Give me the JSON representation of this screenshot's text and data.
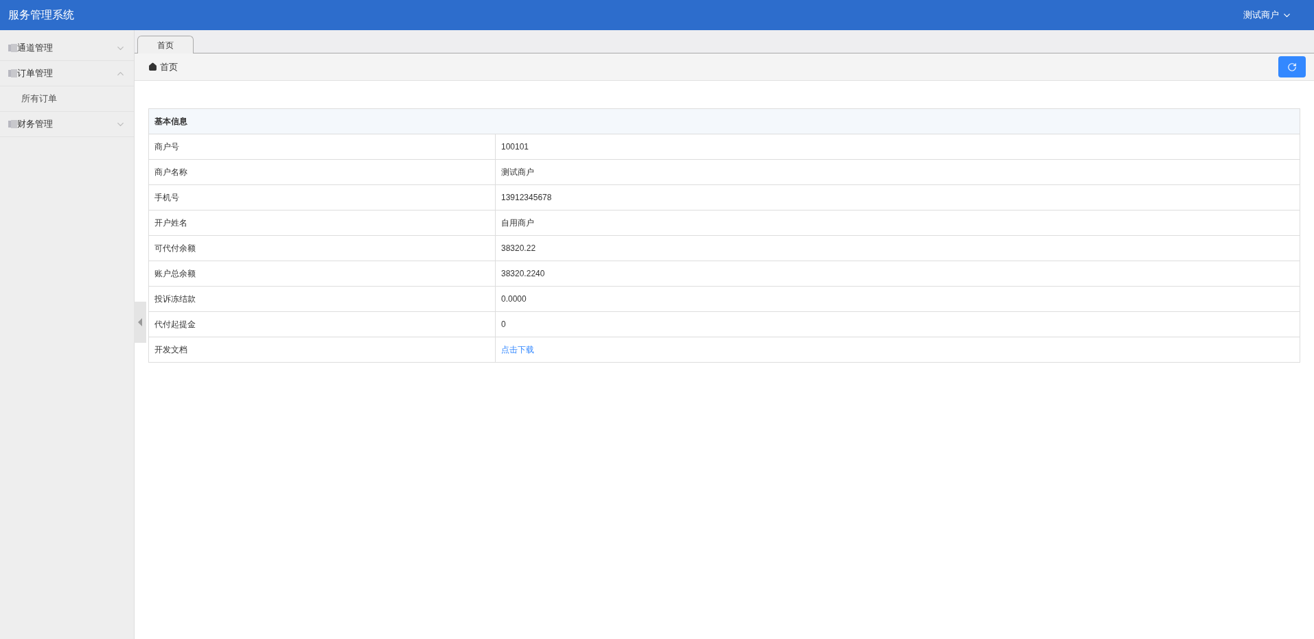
{
  "header": {
    "title": "服务管理系统",
    "user": "测试商户"
  },
  "sidebar": {
    "items": [
      {
        "label": "通道管理",
        "expanded": false
      },
      {
        "label": "订单管理",
        "expanded": true,
        "children": [
          {
            "label": "所有订单"
          }
        ]
      },
      {
        "label": "财务管理",
        "expanded": false
      }
    ]
  },
  "tabs": [
    {
      "label": "首页",
      "selected": true
    }
  ],
  "breadcrumb": "首页",
  "info_table": {
    "title": "基本信息",
    "rows": [
      {
        "label": "商户号",
        "value": "100101",
        "kind": "text"
      },
      {
        "label": "商户名称",
        "value": "测试商户",
        "kind": "text"
      },
      {
        "label": "手机号",
        "value": "13912345678",
        "kind": "text"
      },
      {
        "label": "开户姓名",
        "value": "自用商户",
        "kind": "text"
      },
      {
        "label": "可代付余额",
        "value": "38320.22",
        "kind": "text"
      },
      {
        "label": "账户总余额",
        "value": "38320.2240",
        "kind": "text"
      },
      {
        "label": "投诉冻结款",
        "value": "0.0000",
        "kind": "text"
      },
      {
        "label": "代付起提金",
        "value": "0",
        "kind": "text"
      },
      {
        "label": "开发文档",
        "value": "点击下载",
        "kind": "link"
      }
    ]
  }
}
